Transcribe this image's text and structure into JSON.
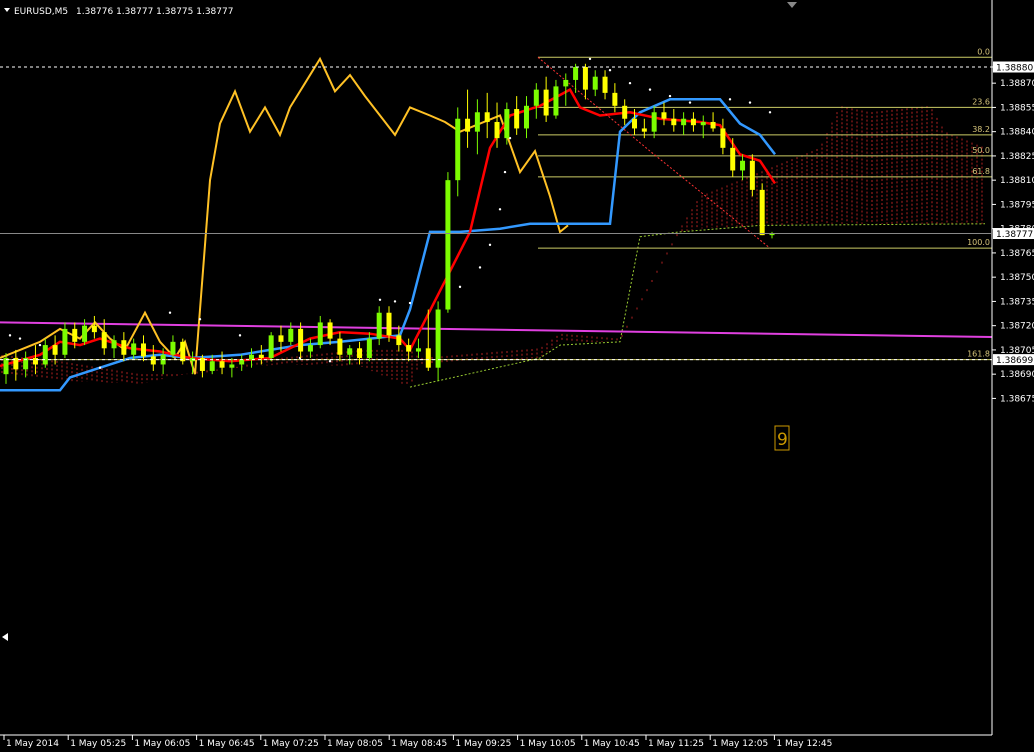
{
  "header": {
    "symbol": "EURUSD,M5",
    "ohlc": "1.38776 1.38777 1.38775 1.38777"
  },
  "colors": {
    "background": "#000000",
    "bull": "#7CFC00",
    "bear": "#FFFF00",
    "kijun": "#FF0000",
    "tenkan": "#3399FF",
    "chikou": "#FFC125",
    "ma": "#E040E0",
    "fib": "#CCCC66",
    "cloud": "#B22222",
    "grid_text": "#FFFFFF"
  },
  "chart_data": {
    "type": "candlestick",
    "title": "EURUSD,M5",
    "ylim": [
      1.38668,
      1.38893
    ],
    "y_ticks": [
      "1.38880",
      "1.38870",
      "1.38855",
      "1.38840",
      "1.38825",
      "1.38810",
      "1.38795",
      "1.38780",
      "1.38765",
      "1.38750",
      "1.38735",
      "1.38720",
      "1.38705",
      "1.38690",
      "1.38675"
    ],
    "x_ticks": [
      "1 May 2014",
      "1 May 05:25",
      "1 May 06:05",
      "1 May 06:45",
      "1 May 07:25",
      "1 May 08:05",
      "1 May 08:45",
      "1 May 09:25",
      "1 May 10:05",
      "1 May 10:45",
      "1 May 11:25",
      "1 May 12:05",
      "1 May 12:45"
    ],
    "current_price": "1.38777",
    "high_price": "1.38880",
    "low_price": "1.38699",
    "candles": [
      {
        "o": 1.3869,
        "h": 1.38703,
        "l": 1.38684,
        "c": 1.387
      },
      {
        "o": 1.387,
        "h": 1.38705,
        "l": 1.38686,
        "c": 1.38693
      },
      {
        "o": 1.38693,
        "h": 1.38704,
        "l": 1.38688,
        "c": 1.387
      },
      {
        "o": 1.387,
        "h": 1.38708,
        "l": 1.3869,
        "c": 1.38696
      },
      {
        "o": 1.38696,
        "h": 1.38712,
        "l": 1.38694,
        "c": 1.38708
      },
      {
        "o": 1.38708,
        "h": 1.38714,
        "l": 1.38696,
        "c": 1.38702
      },
      {
        "o": 1.38702,
        "h": 1.38722,
        "l": 1.387,
        "c": 1.38718
      },
      {
        "o": 1.38718,
        "h": 1.38722,
        "l": 1.38706,
        "c": 1.3871
      },
      {
        "o": 1.3871,
        "h": 1.38724,
        "l": 1.38708,
        "c": 1.3872
      },
      {
        "o": 1.3872,
        "h": 1.38726,
        "l": 1.38712,
        "c": 1.38716
      },
      {
        "o": 1.38716,
        "h": 1.38724,
        "l": 1.38702,
        "c": 1.38706
      },
      {
        "o": 1.38706,
        "h": 1.38714,
        "l": 1.387,
        "c": 1.38711
      },
      {
        "o": 1.38711,
        "h": 1.38716,
        "l": 1.38698,
        "c": 1.38702
      },
      {
        "o": 1.38702,
        "h": 1.38712,
        "l": 1.38699,
        "c": 1.38709
      },
      {
        "o": 1.38709,
        "h": 1.38714,
        "l": 1.38698,
        "c": 1.38701
      },
      {
        "o": 1.38701,
        "h": 1.38708,
        "l": 1.38692,
        "c": 1.38696
      },
      {
        "o": 1.38696,
        "h": 1.38706,
        "l": 1.3869,
        "c": 1.38702
      },
      {
        "o": 1.38702,
        "h": 1.38714,
        "l": 1.387,
        "c": 1.3871
      },
      {
        "o": 1.3871,
        "h": 1.38712,
        "l": 1.38696,
        "c": 1.38698
      },
      {
        "o": 1.38698,
        "h": 1.38704,
        "l": 1.3869,
        "c": 1.387
      },
      {
        "o": 1.387,
        "h": 1.38702,
        "l": 1.38688,
        "c": 1.38692
      },
      {
        "o": 1.38692,
        "h": 1.38702,
        "l": 1.3869,
        "c": 1.38698
      },
      {
        "o": 1.38698,
        "h": 1.38704,
        "l": 1.3869,
        "c": 1.38694
      },
      {
        "o": 1.38694,
        "h": 1.387,
        "l": 1.38688,
        "c": 1.38696
      },
      {
        "o": 1.38696,
        "h": 1.38702,
        "l": 1.38692,
        "c": 1.38699
      },
      {
        "o": 1.38699,
        "h": 1.38706,
        "l": 1.38694,
        "c": 1.38702
      },
      {
        "o": 1.38702,
        "h": 1.38708,
        "l": 1.38696,
        "c": 1.387
      },
      {
        "o": 1.387,
        "h": 1.38716,
        "l": 1.38698,
        "c": 1.38714
      },
      {
        "o": 1.38714,
        "h": 1.3872,
        "l": 1.38704,
        "c": 1.3871
      },
      {
        "o": 1.3871,
        "h": 1.38722,
        "l": 1.38708,
        "c": 1.38718
      },
      {
        "o": 1.38718,
        "h": 1.38722,
        "l": 1.387,
        "c": 1.38704
      },
      {
        "o": 1.38704,
        "h": 1.38712,
        "l": 1.387,
        "c": 1.38708
      },
      {
        "o": 1.38708,
        "h": 1.38726,
        "l": 1.38706,
        "c": 1.38722
      },
      {
        "o": 1.38722,
        "h": 1.38724,
        "l": 1.38708,
        "c": 1.38712
      },
      {
        "o": 1.38712,
        "h": 1.38716,
        "l": 1.38698,
        "c": 1.38702
      },
      {
        "o": 1.38702,
        "h": 1.38708,
        "l": 1.38696,
        "c": 1.38706
      },
      {
        "o": 1.38706,
        "h": 1.3871,
        "l": 1.38696,
        "c": 1.387
      },
      {
        "o": 1.387,
        "h": 1.38716,
        "l": 1.38698,
        "c": 1.38712
      },
      {
        "o": 1.38712,
        "h": 1.38732,
        "l": 1.38708,
        "c": 1.38728
      },
      {
        "o": 1.38728,
        "h": 1.38732,
        "l": 1.3871,
        "c": 1.38714
      },
      {
        "o": 1.38714,
        "h": 1.3872,
        "l": 1.38704,
        "c": 1.38708
      },
      {
        "o": 1.38708,
        "h": 1.38712,
        "l": 1.38698,
        "c": 1.38704
      },
      {
        "o": 1.38704,
        "h": 1.38712,
        "l": 1.387,
        "c": 1.38706
      },
      {
        "o": 1.38706,
        "h": 1.3873,
        "l": 1.38692,
        "c": 1.38694
      },
      {
        "o": 1.38694,
        "h": 1.38735,
        "l": 1.38686,
        "c": 1.3873
      },
      {
        "o": 1.3873,
        "h": 1.38815,
        "l": 1.38728,
        "c": 1.3881
      },
      {
        "o": 1.3881,
        "h": 1.38855,
        "l": 1.388,
        "c": 1.38848
      },
      {
        "o": 1.38848,
        "h": 1.38866,
        "l": 1.3883,
        "c": 1.3884
      },
      {
        "o": 1.3884,
        "h": 1.3886,
        "l": 1.38826,
        "c": 1.38852
      },
      {
        "o": 1.38852,
        "h": 1.38864,
        "l": 1.38836,
        "c": 1.38846
      },
      {
        "o": 1.38846,
        "h": 1.38858,
        "l": 1.3883,
        "c": 1.38836
      },
      {
        "o": 1.38836,
        "h": 1.38858,
        "l": 1.38832,
        "c": 1.38854
      },
      {
        "o": 1.38854,
        "h": 1.38862,
        "l": 1.38838,
        "c": 1.38842
      },
      {
        "o": 1.38842,
        "h": 1.38862,
        "l": 1.38836,
        "c": 1.38856
      },
      {
        "o": 1.38856,
        "h": 1.3887,
        "l": 1.38848,
        "c": 1.38866
      },
      {
        "o": 1.38866,
        "h": 1.38874,
        "l": 1.38846,
        "c": 1.3885
      },
      {
        "o": 1.3885,
        "h": 1.38872,
        "l": 1.38848,
        "c": 1.38868
      },
      {
        "o": 1.38868,
        "h": 1.38876,
        "l": 1.38856,
        "c": 1.38872
      },
      {
        "o": 1.38872,
        "h": 1.38882,
        "l": 1.38864,
        "c": 1.3888
      },
      {
        "o": 1.3888,
        "h": 1.38882,
        "l": 1.3886,
        "c": 1.38866
      },
      {
        "o": 1.38866,
        "h": 1.38878,
        "l": 1.38862,
        "c": 1.38874
      },
      {
        "o": 1.38874,
        "h": 1.38878,
        "l": 1.3886,
        "c": 1.38864
      },
      {
        "o": 1.38864,
        "h": 1.3887,
        "l": 1.38852,
        "c": 1.38856
      },
      {
        "o": 1.38856,
        "h": 1.3886,
        "l": 1.38844,
        "c": 1.38848
      },
      {
        "o": 1.38848,
        "h": 1.38854,
        "l": 1.38838,
        "c": 1.38842
      },
      {
        "o": 1.38842,
        "h": 1.38848,
        "l": 1.38836,
        "c": 1.3884
      },
      {
        "o": 1.3884,
        "h": 1.38856,
        "l": 1.38836,
        "c": 1.38852
      },
      {
        "o": 1.38852,
        "h": 1.38858,
        "l": 1.38844,
        "c": 1.38848
      },
      {
        "o": 1.38848,
        "h": 1.38854,
        "l": 1.3884,
        "c": 1.38844
      },
      {
        "o": 1.38844,
        "h": 1.38852,
        "l": 1.38838,
        "c": 1.38848
      },
      {
        "o": 1.38848,
        "h": 1.38852,
        "l": 1.3884,
        "c": 1.38844
      },
      {
        "o": 1.38844,
        "h": 1.3885,
        "l": 1.38836,
        "c": 1.38846
      },
      {
        "o": 1.38846,
        "h": 1.38852,
        "l": 1.3884,
        "c": 1.38842
      },
      {
        "o": 1.38842,
        "h": 1.38848,
        "l": 1.38826,
        "c": 1.3883
      },
      {
        "o": 1.3883,
        "h": 1.38836,
        "l": 1.38812,
        "c": 1.38816
      },
      {
        "o": 1.38816,
        "h": 1.38826,
        "l": 1.3881,
        "c": 1.38822
      },
      {
        "o": 1.38822,
        "h": 1.38826,
        "l": 1.388,
        "c": 1.38804
      },
      {
        "o": 1.38804,
        "h": 1.38808,
        "l": 1.38776,
        "c": 1.38776
      },
      {
        "o": 1.38776,
        "h": 1.38778,
        "l": 1.38774,
        "c": 1.38777
      }
    ],
    "fib_levels": [
      {
        "label": "0.0",
        "value": 1.38886
      },
      {
        "label": "23.6",
        "value": 1.38855
      },
      {
        "label": "38.2",
        "value": 1.38838
      },
      {
        "label": "50.0",
        "value": 1.38825
      },
      {
        "label": "61.8",
        "value": 1.38812
      },
      {
        "label": "100.0",
        "value": 1.38768
      },
      {
        "label": "161.8",
        "value": 1.38699
      }
    ],
    "marker_label": "9",
    "grid": false
  }
}
